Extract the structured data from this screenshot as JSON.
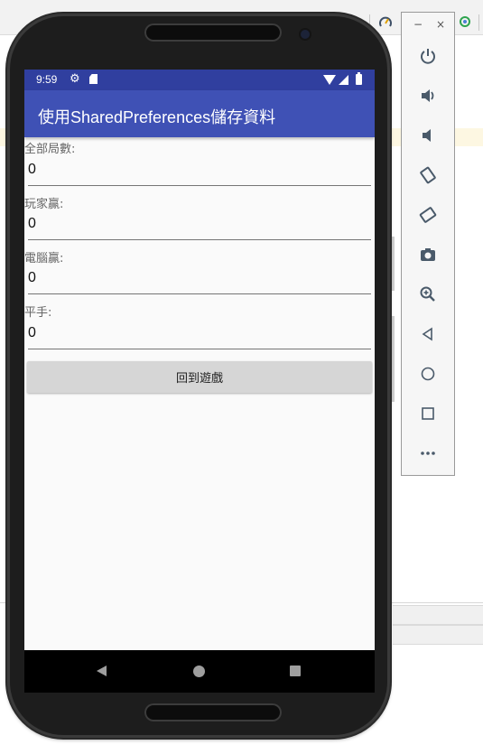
{
  "statusbar": {
    "time": "9:59"
  },
  "appbar": {
    "title": "使用SharedPreferences儲存資料"
  },
  "stats": [
    {
      "label": "全部局數:",
      "value": "0"
    },
    {
      "label": "玩家贏:",
      "value": "0"
    },
    {
      "label": "電腦贏:",
      "value": "0"
    },
    {
      "label": "平手:",
      "value": "0"
    }
  ],
  "back_button": {
    "label": "回到遊戲"
  },
  "emulator_toolbar": {
    "minimize": "−",
    "close": "×",
    "buttons": [
      "power-icon",
      "volume-up-icon",
      "volume-down-icon",
      "rotate-left-icon",
      "rotate-right-icon",
      "camera-icon",
      "zoom-icon",
      "back-icon",
      "home-icon",
      "overview-icon",
      "more-icon"
    ]
  },
  "colors": {
    "statusbar": "#303f9f",
    "appbar": "#3f51b5",
    "button": "#d6d6d6"
  }
}
